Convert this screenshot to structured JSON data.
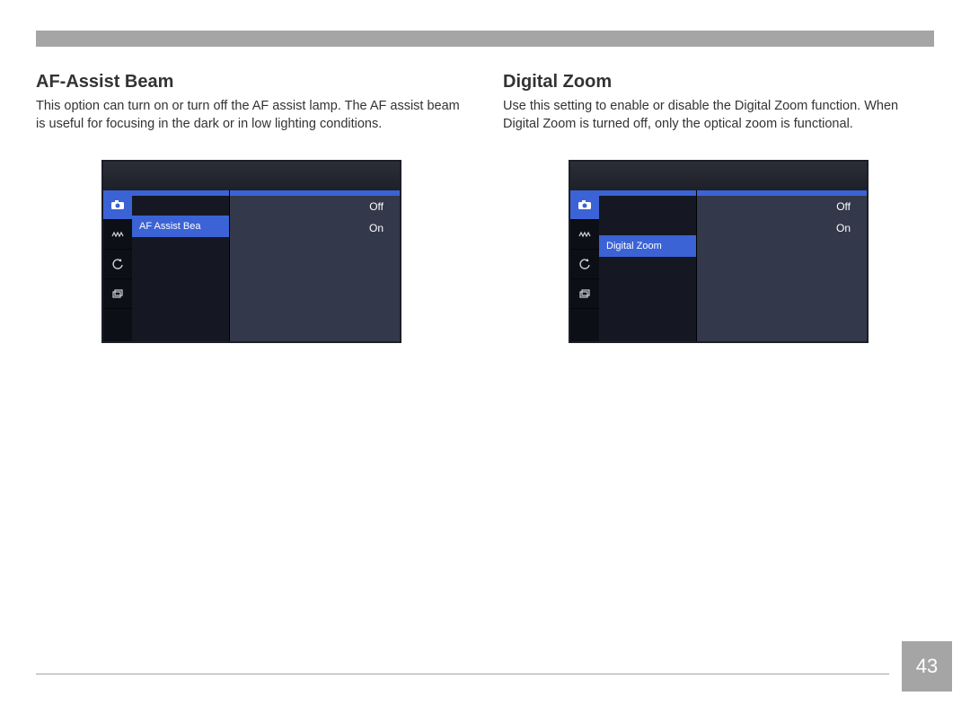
{
  "page_number": "43",
  "left": {
    "title": "AF-Assist Beam",
    "body": "This option can turn on or turn off the AF assist lamp. The AF assist beam is useful for focusing in the dark or in low lighting conditions.",
    "menu_label": "AF Assist Bea",
    "options": [
      "Off",
      "On"
    ],
    "sidebar_icons": [
      "camera",
      "burst",
      "refresh",
      "layers"
    ],
    "menu_item_row": 1
  },
  "right": {
    "title": "Digital Zoom",
    "body": "Use this setting to enable or disable the Digital Zoom function. When Digital Zoom is turned off, only the optical zoom is functional.",
    "menu_label": "Digital Zoom",
    "options": [
      "Off",
      "On"
    ],
    "sidebar_icons": [
      "camera",
      "burst",
      "refresh",
      "layers"
    ],
    "menu_item_row": 2
  }
}
